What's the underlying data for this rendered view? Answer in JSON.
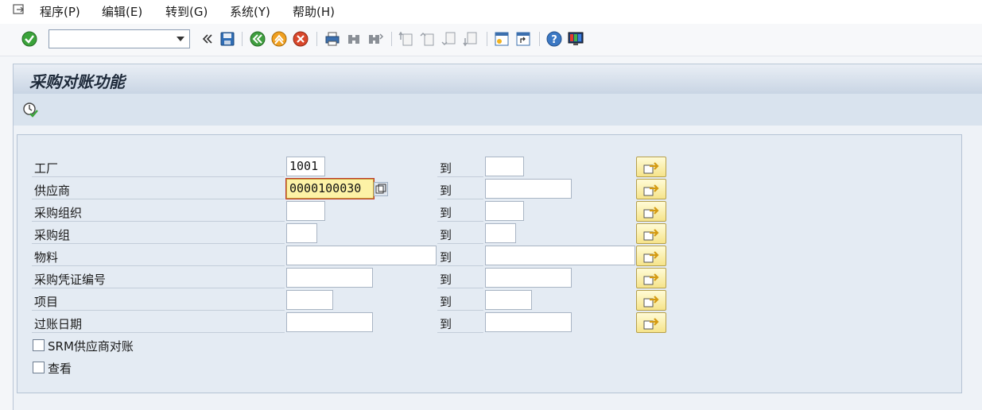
{
  "menu": {
    "items": [
      {
        "label": "程序(P)",
        "icon": "program-icon"
      },
      {
        "label": "编辑(E)"
      },
      {
        "label": "转到(G)"
      },
      {
        "label": "系统(Y)"
      },
      {
        "label": "帮助(H)"
      }
    ]
  },
  "toolbar": {
    "command_field_value": "",
    "icons": [
      "enter-icon",
      "command-dropdown-icon",
      "collapse-icon",
      "save-icon",
      "back-icon",
      "exit-icon",
      "cancel-icon",
      "print-icon",
      "find-icon",
      "find-next-icon",
      "first-page-icon",
      "previous-page-icon",
      "next-page-icon",
      "last-page-icon",
      "create-session-icon",
      "shortcut-icon",
      "help-icon",
      "layout-menu-icon"
    ]
  },
  "page": {
    "title": "采购对账功能"
  },
  "appbar": {
    "icons": [
      "execute-icon"
    ]
  },
  "selection": {
    "to_label": "到",
    "rows": [
      {
        "label": "工厂",
        "low": "1001",
        "high": ""
      },
      {
        "label": "供应商",
        "low": "0000100030",
        "high": ""
      },
      {
        "label": "采购组织",
        "low": "",
        "high": ""
      },
      {
        "label": "采购组",
        "low": "",
        "high": ""
      },
      {
        "label": "物料",
        "low": "",
        "high": ""
      },
      {
        "label": "采购凭证编号",
        "low": "",
        "high": ""
      },
      {
        "label": "项目",
        "low": "",
        "high": ""
      },
      {
        "label": "过账日期",
        "low": "",
        "high": ""
      }
    ],
    "checkboxes": [
      {
        "label": "SRM供应商对账",
        "checked": false
      },
      {
        "label": "查看",
        "checked": false
      }
    ]
  },
  "colors": {
    "focus_field": "#fdf2a6",
    "multi_select_button": "#f6e48a",
    "title_gradient": "#c9d5e4"
  }
}
